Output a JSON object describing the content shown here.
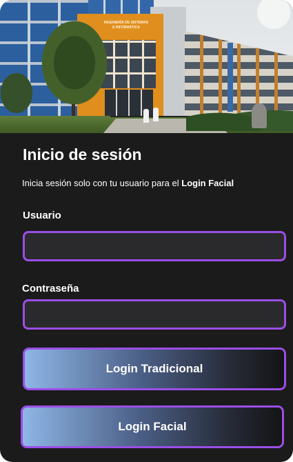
{
  "hero": {
    "sign_line1": "INGENIERÍA DE SISTEMAS",
    "sign_line2": "E INFORMÁTICA"
  },
  "login": {
    "title": "Inicio de sesión",
    "subtitle_prefix": "Inicia sesión solo con tu usuario para el ",
    "subtitle_bold": "Login Facial",
    "username_label": "Usuario",
    "username_value": "",
    "password_label": "Contraseña",
    "password_value": "",
    "btn_traditional": "Login Tradicional",
    "btn_facial": "Login Facial"
  },
  "colors": {
    "background": "#1b1b1b",
    "accent_border": "#9b4ee8",
    "field_bg": "#2a2a2c",
    "button_gradient_start": "#8fb6e6",
    "button_gradient_end": "#141416"
  }
}
